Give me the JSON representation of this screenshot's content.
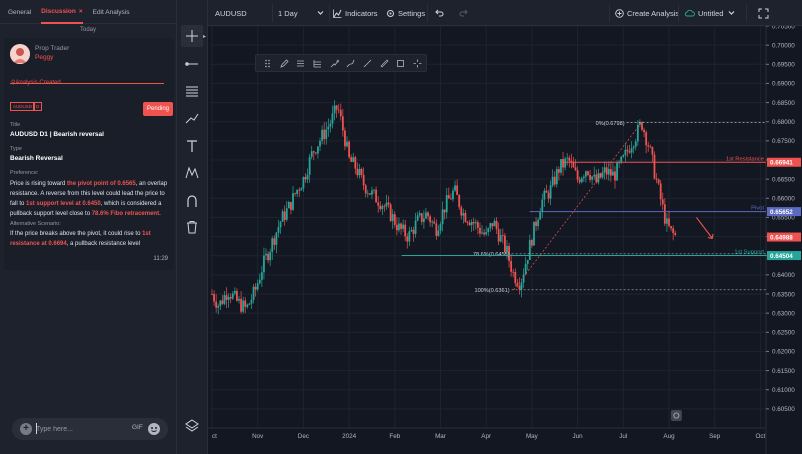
{
  "left_panel": {
    "tabs": [
      {
        "label": "General"
      },
      {
        "label": "Discussion"
      },
      {
        "label": "Edit Analysis"
      }
    ],
    "tab_close": "×",
    "today": "Today",
    "card": {
      "role": "Prop Trader",
      "author": "Peggy",
      "analysis_created": "Analysis Created",
      "symbol_badge": "AUDUSD",
      "timeframe_badge": "D",
      "status": "Pending",
      "title_label": "Title",
      "title": "AUDUSD D1 | Bearish reversal",
      "type_label": "Type",
      "type": "Bearish Reversal",
      "preference_label": "Preference:",
      "preference": {
        "p1": "Price is rising toward ",
        "h1": "the pivot point of 0.6565",
        "p2": ", an overlap resistance. A reverse from this level could lead the price to fall to ",
        "h2": "1st support level at 0.6450",
        "p3": ", which is considered a pullback support level close to ",
        "h3": "78.6% Fibo retracement",
        "p4": "."
      },
      "alt_label": "Alternative Scenario:",
      "alt": {
        "p1": "If the price breaks above the pivot, it could rise to ",
        "h1": "1st resistance at 0.6694",
        "p2": ", a pullback resistance level"
      },
      "time": "11:29"
    },
    "composer": {
      "placeholder": "Type here...",
      "gif": "GIF"
    }
  },
  "topbar": {
    "symbol": "AUDUSD",
    "timeframe": "1 Day",
    "indicators": "Indicators",
    "settings": "Settings",
    "create_analysis": "Create Analysis",
    "layout": "Untitled"
  },
  "chart_data": {
    "type": "candlestick",
    "ylim": [
      0.6,
      0.705
    ],
    "y_ticks": [
      "0.70500",
      "0.70000",
      "0.69500",
      "0.69000",
      "0.68500",
      "0.68000",
      "0.67500",
      "0.67000",
      "0.66500",
      "0.66000",
      "0.65500",
      "0.65000",
      "0.64500",
      "0.64000",
      "0.63500",
      "0.63000",
      "0.62500",
      "0.62000",
      "0.61500",
      "0.61000",
      "0.60500"
    ],
    "x_ticks": [
      {
        "label": "ct",
        "t": 0.0
      },
      {
        "label": "Nov",
        "t": 1.0
      },
      {
        "label": "Dec",
        "t": 2.0
      },
      {
        "label": "2024",
        "t": 3.0
      },
      {
        "label": "Feb",
        "t": 4.0
      },
      {
        "label": "Mar",
        "t": 5.0
      },
      {
        "label": "Apr",
        "t": 6.0
      },
      {
        "label": "May",
        "t": 7.0
      },
      {
        "label": "Jun",
        "t": 8.0
      },
      {
        "label": "Jul",
        "t": 9.0
      },
      {
        "label": "Aug",
        "t": 10.0
      },
      {
        "label": "Sep",
        "t": 11.0
      },
      {
        "label": "Oct",
        "t": 12.0
      }
    ],
    "price_path": [
      [
        0.0,
        0.635
      ],
      [
        0.15,
        0.632
      ],
      [
        0.35,
        0.636
      ],
      [
        0.55,
        0.633
      ],
      [
        0.75,
        0.631
      ],
      [
        0.95,
        0.636
      ],
      [
        1.1,
        0.642
      ],
      [
        1.3,
        0.648
      ],
      [
        1.5,
        0.654
      ],
      [
        1.7,
        0.658
      ],
      [
        1.85,
        0.662
      ],
      [
        2.0,
        0.665
      ],
      [
        2.2,
        0.672
      ],
      [
        2.4,
        0.676
      ],
      [
        2.6,
        0.68
      ],
      [
        2.75,
        0.684
      ],
      [
        2.9,
        0.676
      ],
      [
        3.0,
        0.67
      ],
      [
        3.15,
        0.668
      ],
      [
        3.3,
        0.664
      ],
      [
        3.5,
        0.661
      ],
      [
        3.7,
        0.659
      ],
      [
        3.9,
        0.656
      ],
      [
        4.1,
        0.652
      ],
      [
        4.3,
        0.65
      ],
      [
        4.5,
        0.654
      ],
      [
        4.7,
        0.656
      ],
      [
        4.9,
        0.652
      ],
      [
        5.1,
        0.658
      ],
      [
        5.3,
        0.662
      ],
      [
        5.5,
        0.656
      ],
      [
        5.7,
        0.654
      ],
      [
        5.85,
        0.652
      ],
      [
        6.0,
        0.65
      ],
      [
        6.15,
        0.654
      ],
      [
        6.3,
        0.65
      ],
      [
        6.45,
        0.646
      ],
      [
        6.6,
        0.64
      ],
      [
        6.75,
        0.638
      ],
      [
        6.9,
        0.645
      ],
      [
        7.05,
        0.652
      ],
      [
        7.2,
        0.659
      ],
      [
        7.4,
        0.662
      ],
      [
        7.6,
        0.668
      ],
      [
        7.8,
        0.67
      ],
      [
        8.0,
        0.665
      ],
      [
        8.2,
        0.668
      ],
      [
        8.4,
        0.664
      ],
      [
        8.6,
        0.667
      ],
      [
        8.8,
        0.666
      ],
      [
        9.0,
        0.67
      ],
      [
        9.15,
        0.674
      ],
      [
        9.3,
        0.677
      ],
      [
        9.4,
        0.6798
      ],
      [
        9.55,
        0.674
      ],
      [
        9.7,
        0.666
      ],
      [
        9.85,
        0.658
      ],
      [
        9.95,
        0.653
      ],
      [
        10.05,
        0.651
      ],
      [
        10.15,
        0.65
      ]
    ],
    "levels": [
      {
        "name": "1st Resistance",
        "value": 0.66941,
        "label": "0.66941",
        "color": "#ef5350"
      },
      {
        "name": "Pivot",
        "value": 0.65652,
        "label": "0.65652",
        "color": "#5c6bc0"
      },
      {
        "name": "1st Support",
        "value": 0.64504,
        "label": "0.64504",
        "color": "#26a69a"
      }
    ],
    "current_price": {
      "value": 0.64988,
      "label": "0.64988"
    },
    "fib": [
      {
        "label": "0%(0.6798)",
        "value": 0.6798
      },
      {
        "label": "78.6%(0.6455)",
        "value": 0.6455
      },
      {
        "label": "100%(0.6361)",
        "value": 0.6361
      }
    ]
  }
}
